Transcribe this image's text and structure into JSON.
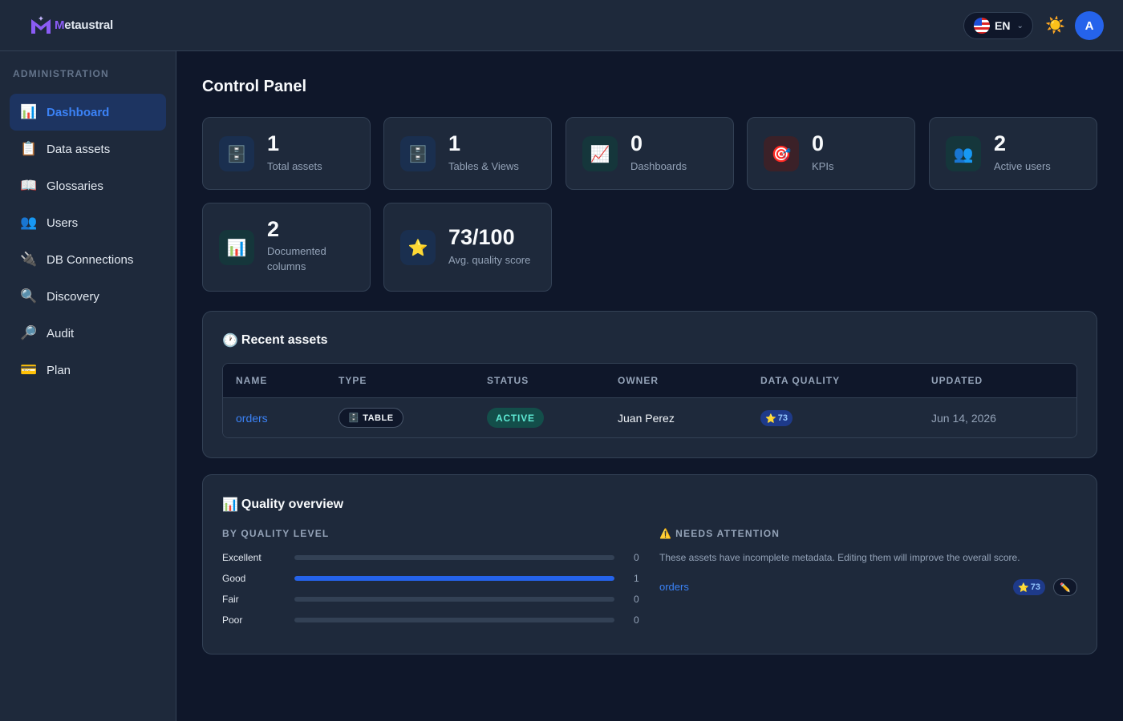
{
  "app": {
    "brand_prefix": "M",
    "brand_rest": "etaustral"
  },
  "topbar": {
    "language": "EN",
    "theme_icon": "☀️",
    "avatar_initial": "A"
  },
  "sidebar": {
    "heading": "ADMINISTRATION",
    "items": [
      {
        "label": "Dashboard",
        "icon": "📊",
        "active": true
      },
      {
        "label": "Data assets",
        "icon": "📋"
      },
      {
        "label": "Glossaries",
        "icon": "📖"
      },
      {
        "label": "Users",
        "icon": "👥"
      },
      {
        "label": "DB Connections",
        "icon": "🔌"
      },
      {
        "label": "Discovery",
        "icon": "🔍"
      },
      {
        "label": "Audit",
        "icon": "🔎"
      },
      {
        "label": "Plan",
        "icon": "💳"
      }
    ]
  },
  "page": {
    "title": "Control Panel"
  },
  "stats": [
    {
      "value": "1",
      "label": "Total assets",
      "icon": "🗄️"
    },
    {
      "value": "1",
      "label": "Tables & Views",
      "icon": "🗄️"
    },
    {
      "value": "0",
      "label": "Dashboards",
      "icon": "📈"
    },
    {
      "value": "0",
      "label": "KPIs",
      "icon": "🎯"
    },
    {
      "value": "2",
      "label": "Active users",
      "icon": "👥"
    },
    {
      "value": "2",
      "label": "Documented columns",
      "icon": "📊"
    },
    {
      "value": "73/100",
      "label": "Avg. quality score",
      "icon": "⭐"
    }
  ],
  "recent": {
    "title_icon": "🕐",
    "title": "Recent assets",
    "columns": [
      "NAME",
      "TYPE",
      "STATUS",
      "OWNER",
      "DATA QUALITY",
      "UPDATED"
    ],
    "rows": [
      {
        "name": "orders",
        "type_icon": "🗄️",
        "type": "TABLE",
        "status": "ACTIVE",
        "owner": "Juan Perez",
        "quality_icon": "⭐",
        "quality": "73",
        "updated": "Jun 14, 2026"
      }
    ]
  },
  "quality": {
    "title_icon": "📊",
    "title": "Quality overview",
    "by_level_heading": "BY QUALITY LEVEL",
    "levels": [
      {
        "label": "Excellent",
        "count": "0",
        "fraction": 0
      },
      {
        "label": "Good",
        "count": "1",
        "fraction": 1
      },
      {
        "label": "Fair",
        "count": "0",
        "fraction": 0
      },
      {
        "label": "Poor",
        "count": "0",
        "fraction": 0
      }
    ],
    "attention_icon": "⚠️",
    "attention_heading": "NEEDS ATTENTION",
    "attention_text": "These assets have incomplete metadata. Editing them will improve the overall score.",
    "attention_items": [
      {
        "name": "orders",
        "quality_icon": "⭐",
        "quality": "73",
        "edit_icon": "✏️"
      }
    ]
  }
}
